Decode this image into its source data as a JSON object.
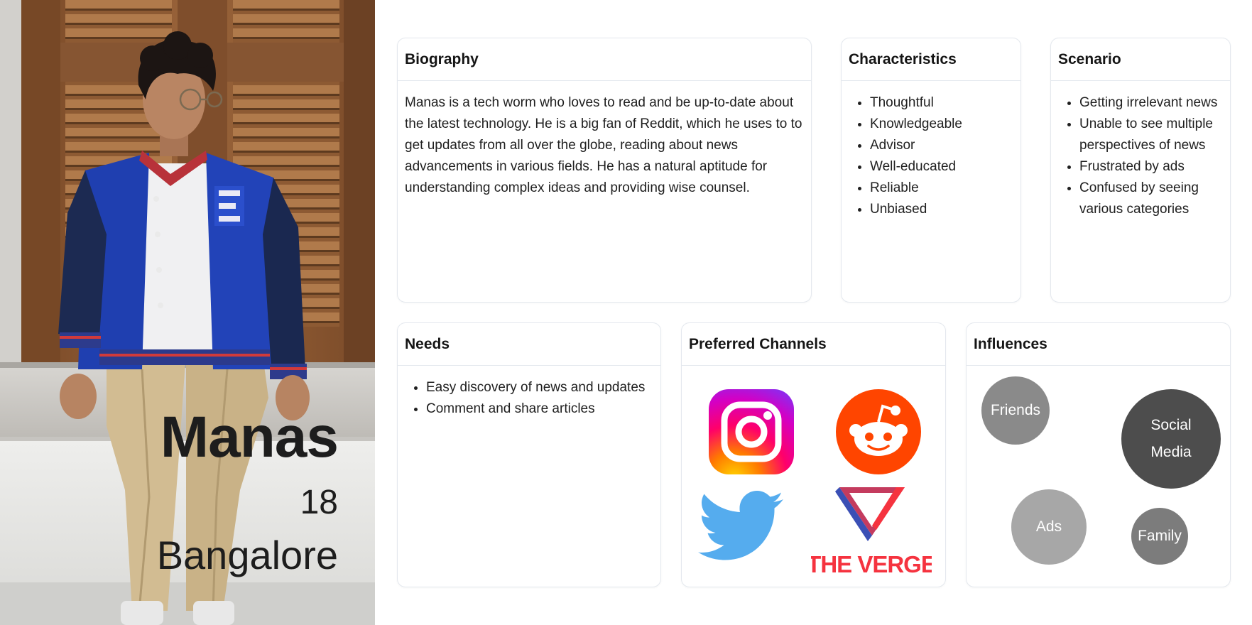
{
  "persona": {
    "name": "Manas",
    "age": "18",
    "city": "Bangalore"
  },
  "biography": {
    "title": "Biography",
    "text": "Manas is a tech worm who loves to read and be up-to-date about the latest technology. He is a big fan of Reddit, which he uses to to get updates from all over the globe, reading about news advancements in various fields. He has a natural aptitude for understanding complex ideas and providing wise counsel."
  },
  "characteristics": {
    "title": "Characteristics",
    "items": [
      "Thoughtful",
      "Knowledgeable",
      "Advisor",
      "Well-educated",
      "Reliable",
      "Unbiased"
    ]
  },
  "scenario": {
    "title": "Scenario",
    "items": [
      "Getting irrelevant news",
      "Unable to see multiple perspectives of news",
      "Frustrated by ads",
      "Confused by seeing various categories"
    ]
  },
  "needs": {
    "title": "Needs",
    "items": [
      "Easy discovery of news and updates",
      "Comment and share articles"
    ]
  },
  "channels": {
    "title": "Preferred Channels",
    "logos": {
      "instagram": "instagram-icon",
      "reddit": "reddit-icon",
      "twitter": "twitter-icon",
      "verge": "the-verge-logo"
    },
    "verge_wordmark": "THE VERGE",
    "colors": {
      "reddit": "#ff4500",
      "twitter": "#55acee",
      "verge": "#f5333f"
    }
  },
  "influences": {
    "title": "Influences",
    "bubbles": [
      {
        "label": "Friends",
        "color": "#8a8a8a"
      },
      {
        "label": "Social Media",
        "color": "#4d4d4d"
      },
      {
        "label": "Ads",
        "color": "#a7a7a7"
      },
      {
        "label": "Family",
        "color": "#7c7c7c"
      }
    ]
  }
}
